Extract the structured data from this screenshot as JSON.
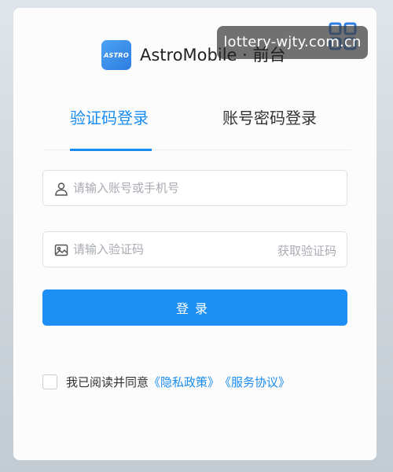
{
  "watermark": {
    "text": "lottery-wjty.com.cn"
  },
  "header": {
    "logo_text": "ASTRO",
    "brand": "AstroMobile · 前台"
  },
  "tabs": [
    {
      "label": "验证码登录",
      "active": true
    },
    {
      "label": "账号密码登录",
      "active": false
    }
  ],
  "form": {
    "account_placeholder": "请输入账号或手机号",
    "code_placeholder": "请输入验证码",
    "get_code_label": "获取验证码",
    "login_label": "登录"
  },
  "agreement": {
    "prefix": "我已阅读并同意",
    "privacy_link": "《隐私政策》",
    "service_link": "《服务协议》",
    "checked": false
  },
  "colors": {
    "accent": "#1a8cf0",
    "button": "#1e90f5"
  },
  "icons": {
    "qr": "qr-code-icon",
    "account": "user-icon",
    "code": "image-icon"
  }
}
